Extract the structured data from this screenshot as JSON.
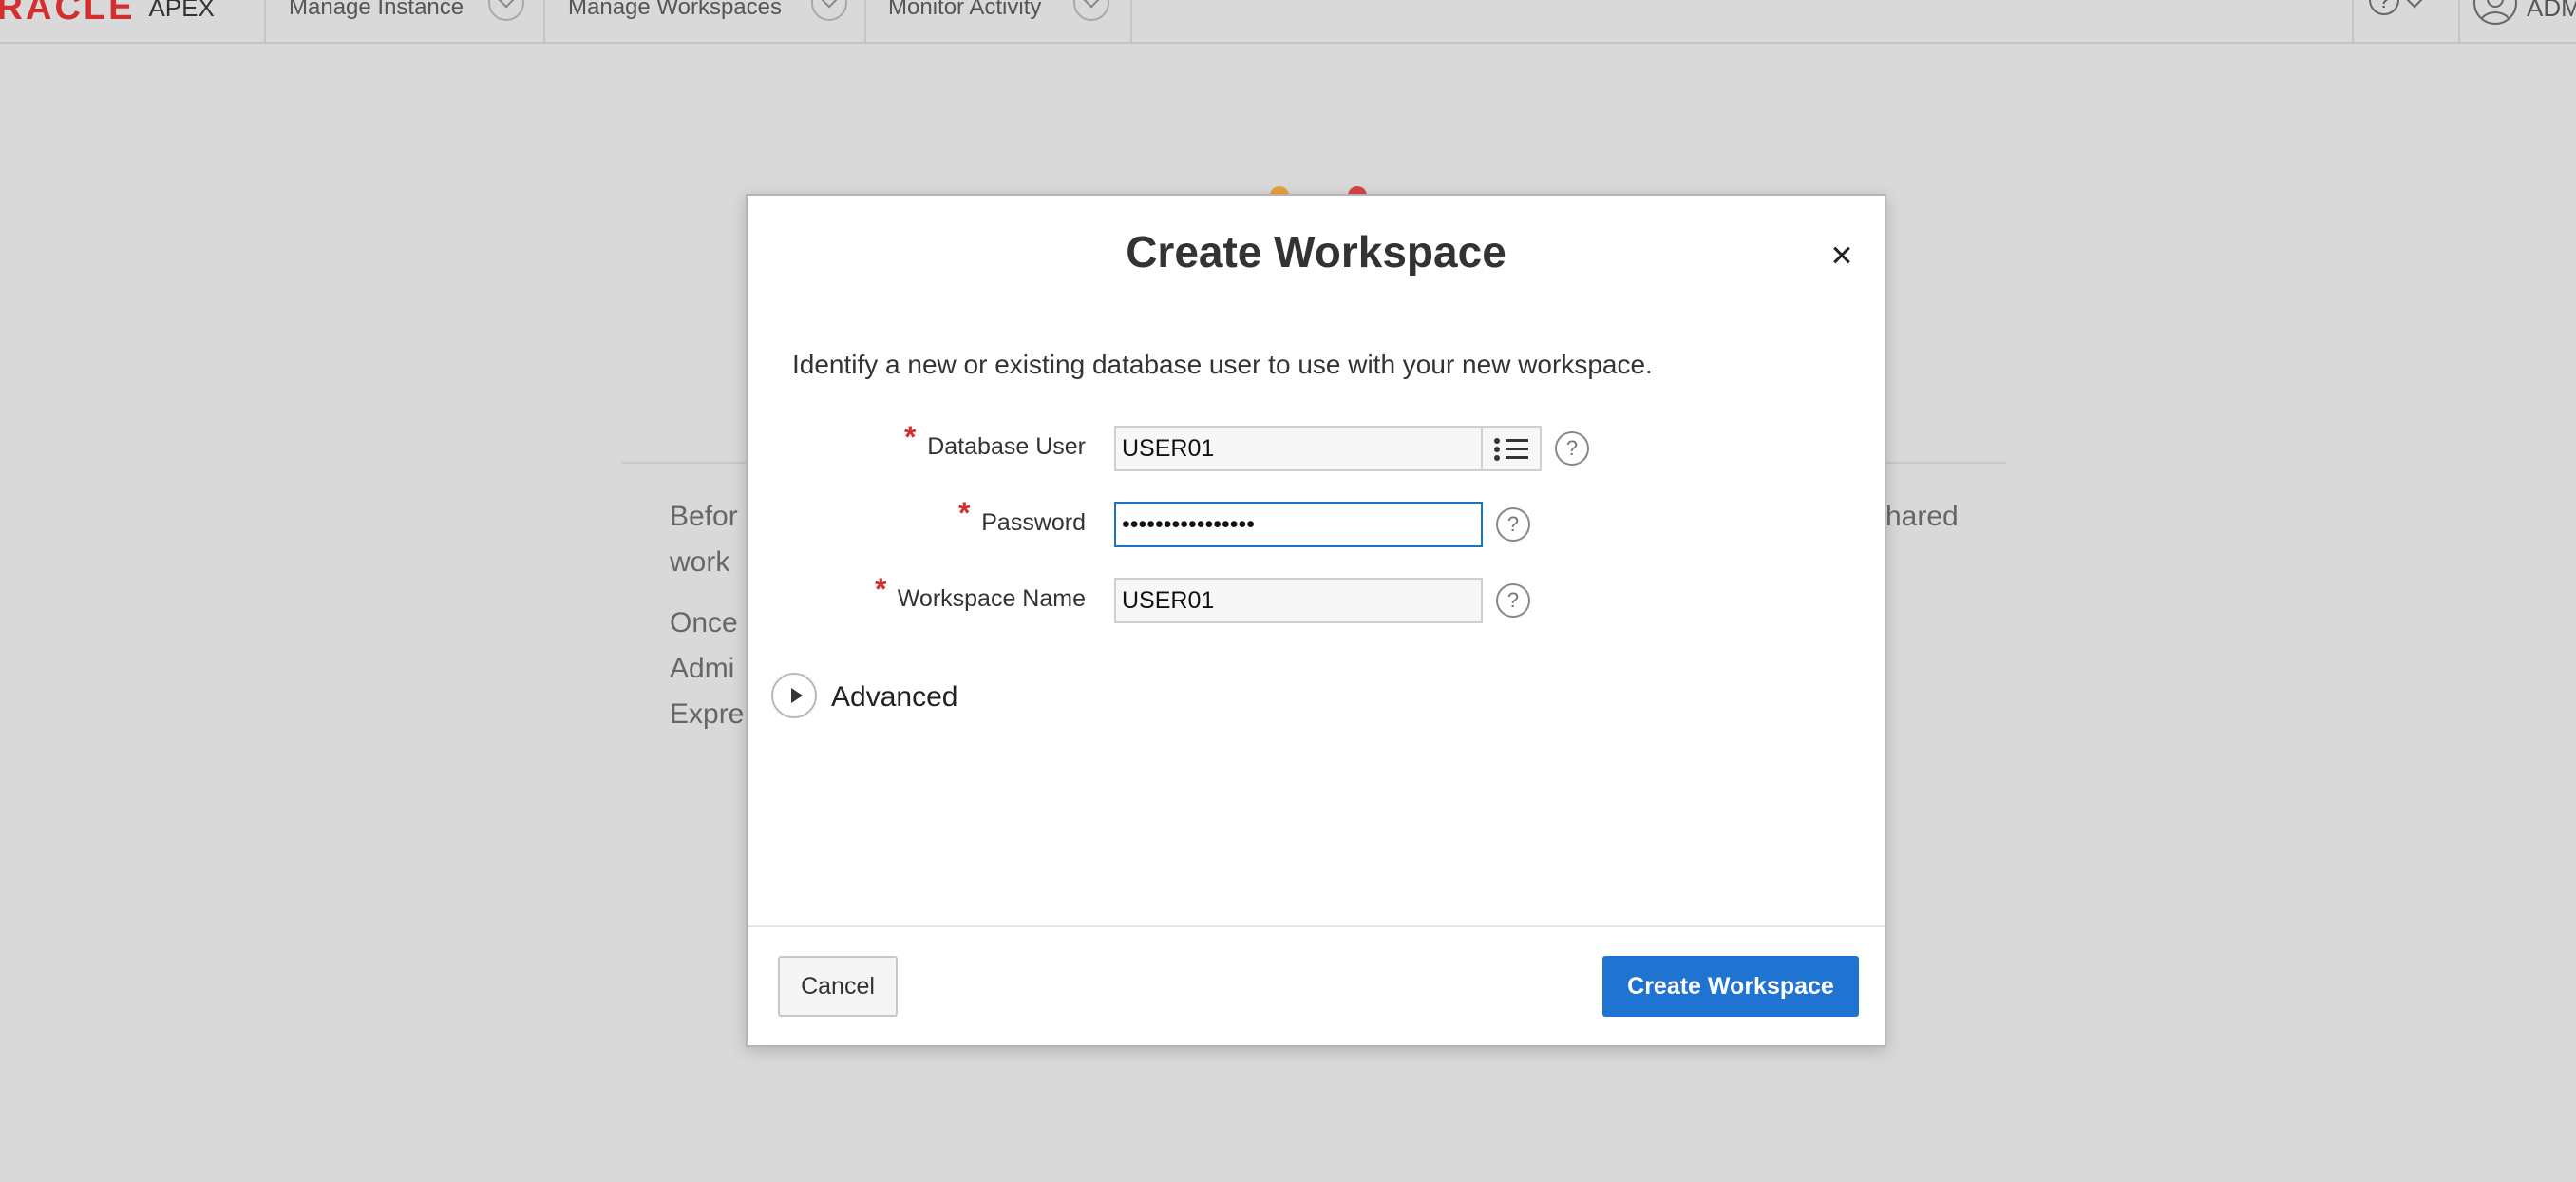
{
  "header": {
    "brand_oracle": "ORACLE",
    "brand_apex": "APEX",
    "nav": [
      {
        "label": "Manage Instance"
      },
      {
        "label": "Manage Workspaces"
      },
      {
        "label": "Monitor Activity"
      }
    ],
    "help_symbol": "?",
    "user_label": "ADM"
  },
  "background": {
    "text_before": "Befor",
    "text_work": "work",
    "text_shared": "hared",
    "text_once": "Once",
    "text_admin": "Admi",
    "text_expr": "Expre"
  },
  "dialog": {
    "title": "Create Workspace",
    "instruction": "Identify a new or existing database user to use with your new workspace.",
    "required_marker": "*",
    "fields": {
      "database_user": {
        "label": "Database User",
        "value": "USER01"
      },
      "password": {
        "label": "Password",
        "value": "••••••••••••••••"
      },
      "workspace_name": {
        "label": "Workspace Name",
        "value": "USER01"
      }
    },
    "help_symbol": "?",
    "advanced_label": "Advanced",
    "cancel_label": "Cancel",
    "create_label": "Create Workspace"
  },
  "icons": {
    "close": "close-icon",
    "lov": "list-icon",
    "help": "help-icon",
    "expand": "chevron-right-icon",
    "user": "user-icon"
  },
  "colors": {
    "brand_red": "#d32f2f",
    "primary_button": "#1f74d1",
    "focus_border": "#1a73c6",
    "page_background": "#d9d9d9"
  }
}
